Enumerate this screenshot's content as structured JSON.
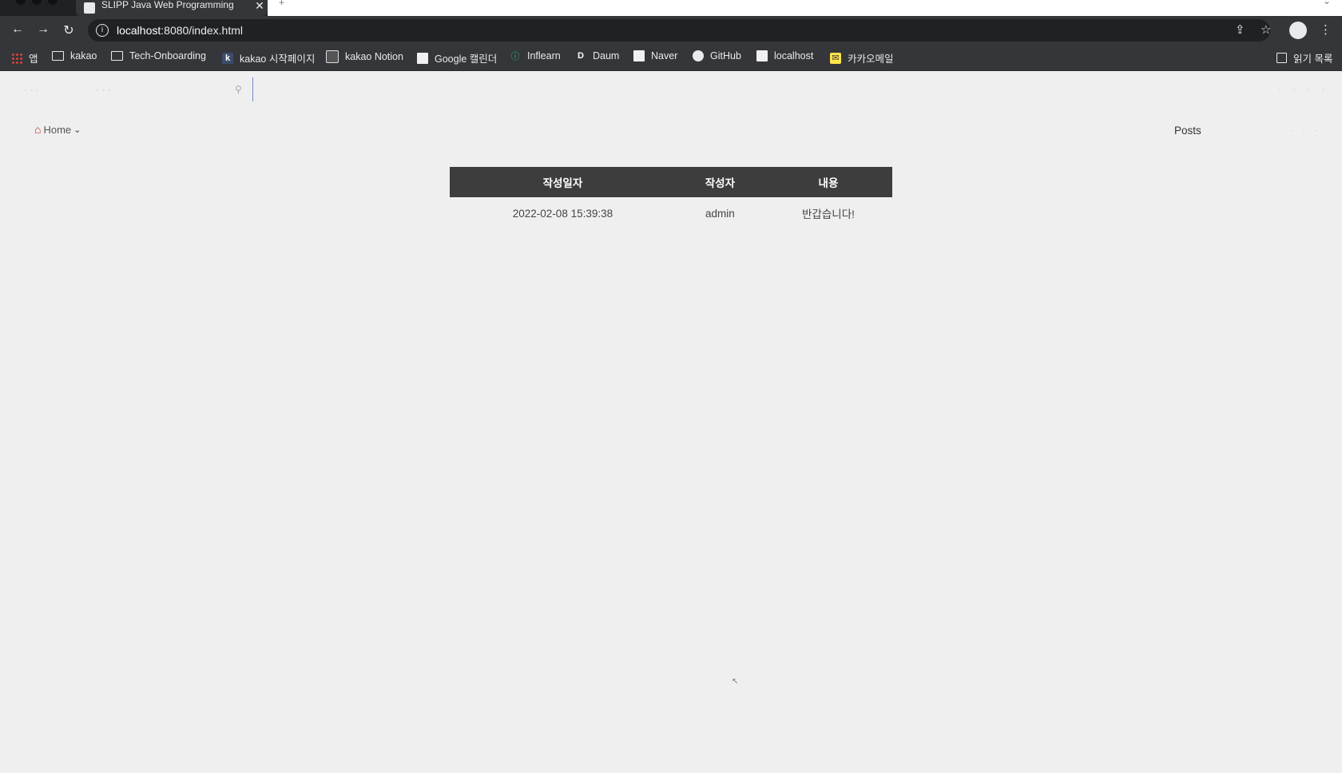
{
  "browser": {
    "tab_title": "SLIPP Java Web Programming",
    "tab_close": "✕",
    "new_tab": "+",
    "url_host": "localhost",
    "url_rest": ":8080/index.html",
    "info_symbol": "i",
    "nav": {
      "back": "←",
      "forward": "→",
      "reload": "↻"
    },
    "actions": {
      "share": "⇪",
      "bookmark": "☆",
      "menu": "⋮"
    },
    "bookmarks": [
      {
        "label": "앱",
        "icon": "apps-grid-icon"
      },
      {
        "label": "kakao",
        "icon": "folder-icon"
      },
      {
        "label": "Tech-Onboarding",
        "icon": "folder-icon"
      },
      {
        "label": "kakao 시작페이지",
        "icon": "kakao-k-icon"
      },
      {
        "label": "kakao Notion",
        "icon": "calendar-icon"
      },
      {
        "label": "Google 캘린더",
        "icon": "google-docs-icon"
      },
      {
        "label": "Inflearn",
        "icon": "inflearn-icon"
      },
      {
        "label": "Daum",
        "icon": "daum-icon"
      },
      {
        "label": "Naver",
        "icon": "page-icon"
      },
      {
        "label": "GitHub",
        "icon": "github-icon"
      },
      {
        "label": "localhost",
        "icon": "page-icon"
      },
      {
        "label": "카카오메일",
        "icon": "mail-icon"
      }
    ],
    "reading_list": "읽기 목록"
  },
  "page": {
    "nav": {
      "home_label": "Home",
      "posts_label": "Posts",
      "home_icon": "home-icon",
      "accent": "#d0211c"
    },
    "table": {
      "header_bg": "#3d3d3d",
      "columns": [
        "작성일자",
        "작성자",
        "내용"
      ],
      "rows": [
        {
          "date": "2022-02-08 15:39:38",
          "author": "admin",
          "content": "반갑습니다!"
        }
      ]
    }
  }
}
